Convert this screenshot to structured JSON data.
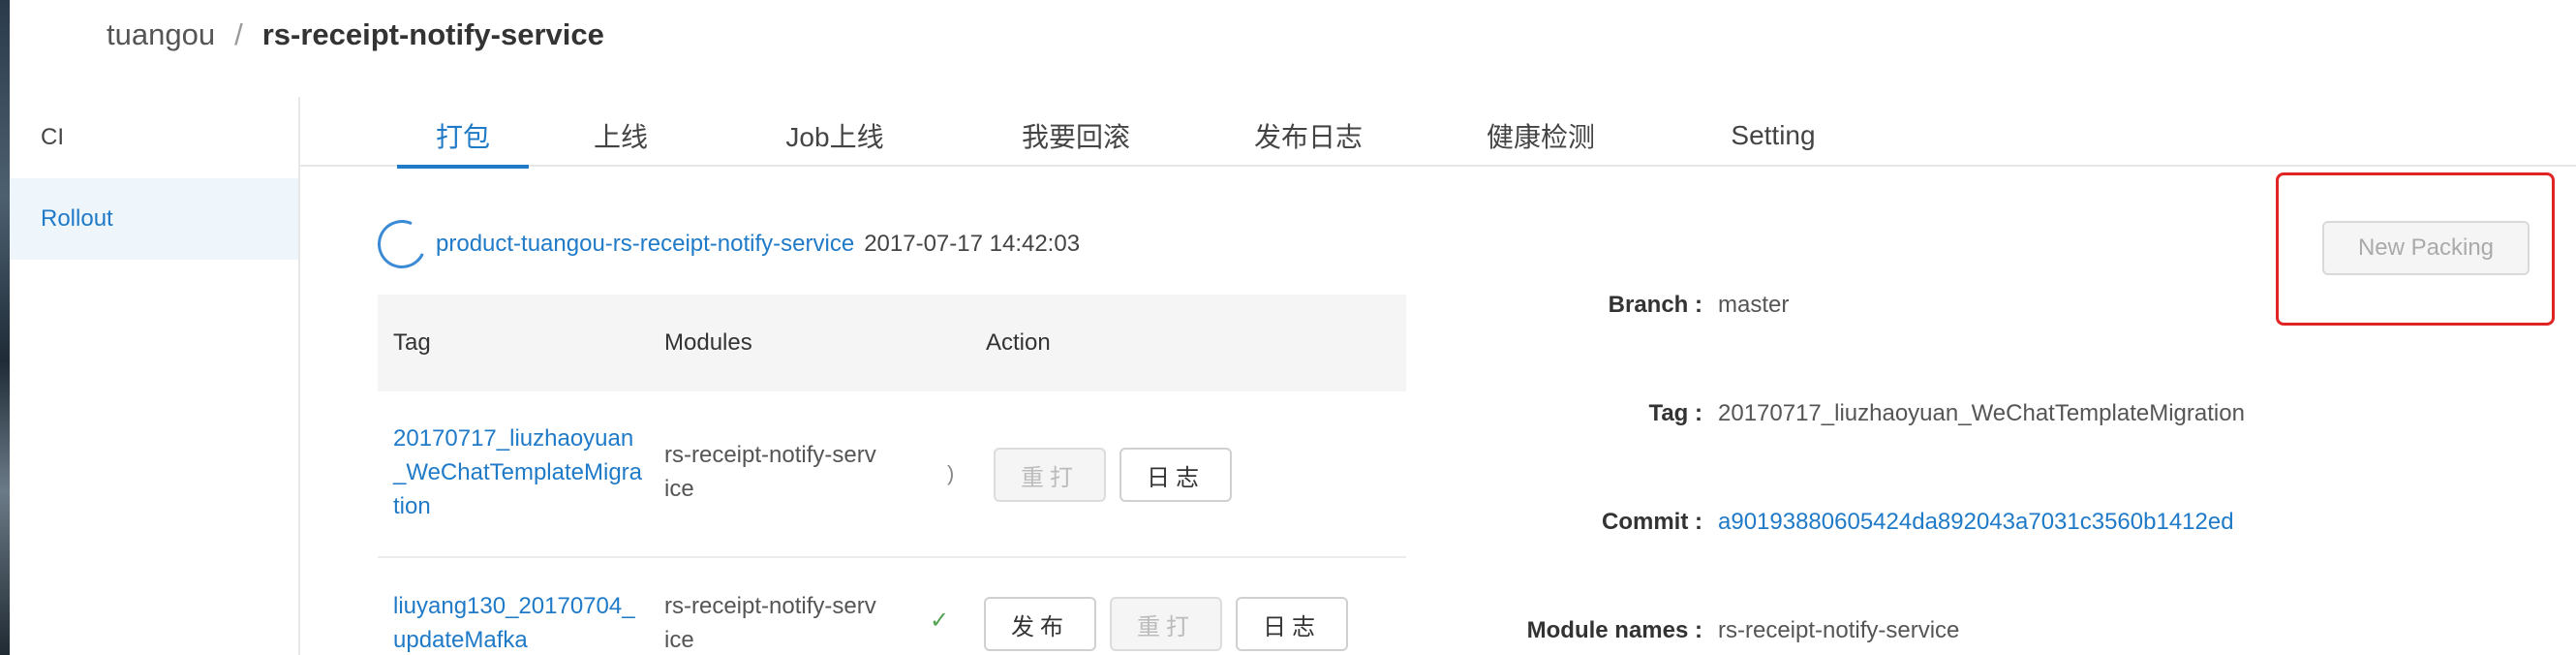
{
  "breadcrumb": {
    "root": "tuangou",
    "separator": "/",
    "current": "rs-receipt-notify-service"
  },
  "sidebar": {
    "items": [
      {
        "label": "CI"
      },
      {
        "label": "Rollout",
        "active": true
      }
    ]
  },
  "tabs": [
    {
      "label": "打包",
      "active": true
    },
    {
      "label": "上线"
    },
    {
      "label": "Job上线"
    },
    {
      "label": "我要回滚"
    },
    {
      "label": "发布日志"
    },
    {
      "label": "健康检测"
    },
    {
      "label": "Setting"
    }
  ],
  "package": {
    "name": "product-tuangou-rs-receipt-notify-service",
    "time": "2017-07-17 14:42:03"
  },
  "table": {
    "headers": {
      "tag": "Tag",
      "modules": "Modules",
      "action": "Action"
    },
    "rows": [
      {
        "tag": "20170717_liuzhaoyuan_WeChatTemplateMigration",
        "modules": "rs-receipt-notify-service",
        "status": ")",
        "publish": "",
        "rebuild": "重打",
        "log": "日志"
      },
      {
        "tag": "liuyang130_20170704_updateMafka",
        "modules": "rs-receipt-notify-service",
        "status": "✓",
        "publish": "发布",
        "rebuild": "重打",
        "log": "日志"
      }
    ]
  },
  "new_packing": {
    "label": "New Packing",
    "disabled": true
  },
  "details": {
    "branch": {
      "label": "Branch :",
      "value": "master"
    },
    "tag": {
      "label": "Tag :",
      "value": "20170717_liuzhaoyuan_WeChatTemplateMigration"
    },
    "commit": {
      "label": "Commit :",
      "value": "a90193880605424da892043a7031c3560b1412ed"
    },
    "module_names": {
      "label": "Module names :",
      "value": "rs-receipt-notify-service"
    }
  },
  "colors": {
    "accent": "#1f7ac8",
    "highlight": "#e02424",
    "success": "#52a352"
  }
}
